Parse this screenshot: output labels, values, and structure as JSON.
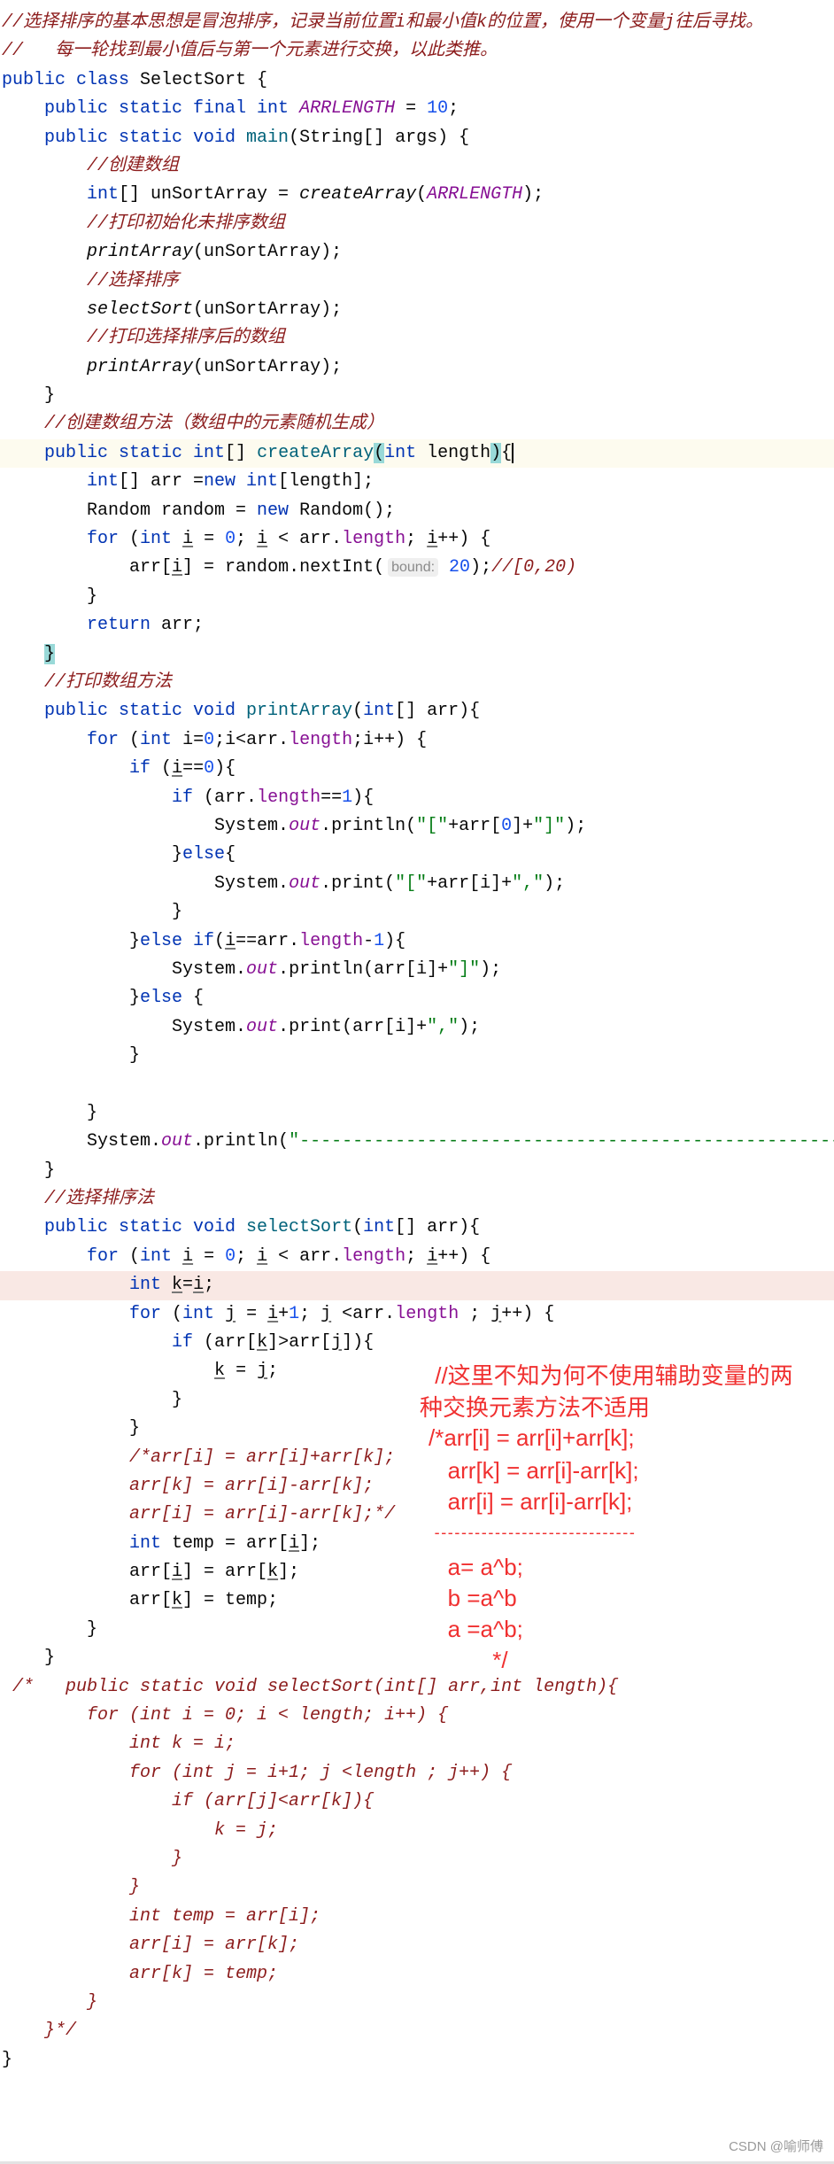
{
  "code": {
    "lines": [
      [
        [
          "//选择排序的基本思想是冒泡排序，记录当前位置i和最小值k的位置，使用一个变量j往后寻找。",
          "cm"
        ]
      ],
      [
        [
          "//   每一轮找到最小值后与第一个元素进行交换，以此类推。",
          "cm"
        ]
      ],
      [
        [
          "public class ",
          "kw"
        ],
        [
          "SelectSort {",
          ""
        ]
      ],
      [
        [
          "    public static final int ",
          "kw"
        ],
        [
          "ARRLENGTH",
          "cst"
        ],
        [
          " = ",
          ""
        ],
        [
          "10",
          "num"
        ],
        [
          ";",
          ""
        ]
      ],
      [
        [
          "    public static void ",
          "kw"
        ],
        [
          "main",
          "fn"
        ],
        [
          "(String[] args) {",
          ""
        ]
      ],
      [
        [
          "        //创建数组",
          "cm"
        ]
      ],
      [
        [
          "        int",
          "kw"
        ],
        [
          "[] unSortArray = ",
          ""
        ],
        [
          "createArray",
          "it"
        ],
        [
          "(",
          ""
        ],
        [
          "ARRLENGTH",
          "cst"
        ],
        [
          ");",
          ""
        ]
      ],
      [
        [
          "        //打印初始化未排序数组",
          "cm"
        ]
      ],
      [
        [
          "        printArray",
          "it"
        ],
        [
          "(unSortArray);",
          ""
        ]
      ],
      [
        [
          "        //选择排序",
          "cm"
        ]
      ],
      [
        [
          "        selectSort",
          "it"
        ],
        [
          "(unSortArray);",
          ""
        ]
      ],
      [
        [
          "        //打印选择排序后的数组",
          "cm"
        ]
      ],
      [
        [
          "        printArray",
          "it"
        ],
        [
          "(unSortArray);",
          ""
        ]
      ],
      [
        [
          "    }",
          ""
        ]
      ],
      [
        [
          "    //创建数组方法（数组中的元素随机生成）",
          "cm"
        ]
      ],
      [
        [
          "    public static int",
          "kw"
        ],
        [
          "[] ",
          ""
        ],
        [
          "createArray",
          "fn"
        ],
        [
          "(",
          "br"
        ],
        [
          "int",
          "kw"
        ],
        [
          " length",
          ""
        ],
        [
          ")",
          "br"
        ],
        [
          "{",
          "caret"
        ]
      ],
      [
        [
          "        int",
          "kw"
        ],
        [
          "[] arr =",
          ""
        ],
        [
          "new int",
          "kw"
        ],
        [
          "[length];",
          ""
        ]
      ],
      [
        [
          "        Random random = ",
          ""
        ],
        [
          "new",
          "kw"
        ],
        [
          " Random();",
          ""
        ]
      ],
      [
        [
          "        for ",
          "kw"
        ],
        [
          "(",
          ""
        ],
        [
          "int ",
          "kw"
        ],
        [
          "i",
          "u"
        ],
        [
          " = ",
          ""
        ],
        [
          "0",
          "num"
        ],
        [
          "; ",
          ""
        ],
        [
          "i",
          "u"
        ],
        [
          " < arr.",
          ""
        ],
        [
          "length",
          "fld"
        ],
        [
          "; ",
          ""
        ],
        [
          "i",
          "u"
        ],
        [
          "++) {",
          ""
        ]
      ],
      [
        [
          "            arr[",
          ""
        ],
        [
          "i",
          "u"
        ],
        [
          "] = random.nextInt(",
          ""
        ],
        [
          "bound:",
          "hint"
        ],
        [
          " ",
          ""
        ],
        [
          "20",
          "num"
        ],
        [
          ");",
          ""
        ],
        [
          "//[0,20)",
          "cm"
        ]
      ],
      [
        [
          "        }",
          ""
        ]
      ],
      [
        [
          "        return",
          "kw"
        ],
        [
          " arr;",
          ""
        ]
      ],
      [
        [
          "    ",
          ""
        ],
        [
          "}",
          "brc"
        ]
      ],
      [
        [
          "    //打印数组方法",
          "cm"
        ]
      ],
      [
        [
          "    public static void ",
          "kw"
        ],
        [
          "printArray",
          "fn"
        ],
        [
          "(",
          ""
        ],
        [
          "int",
          "kw"
        ],
        [
          "[] arr){",
          ""
        ]
      ],
      [
        [
          "        for ",
          "kw"
        ],
        [
          "(",
          ""
        ],
        [
          "int ",
          "kw"
        ],
        [
          "i=",
          ""
        ],
        [
          "0",
          "num"
        ],
        [
          ";i<arr.",
          ""
        ],
        [
          "length",
          "fld"
        ],
        [
          ";i++) {",
          ""
        ]
      ],
      [
        [
          "            if ",
          "kw"
        ],
        [
          "(",
          ""
        ],
        [
          "i",
          "u"
        ],
        [
          "==",
          ""
        ],
        [
          "0",
          "num"
        ],
        [
          "){",
          ""
        ]
      ],
      [
        [
          "                if ",
          "kw"
        ],
        [
          "(arr.",
          ""
        ],
        [
          "length",
          "fld"
        ],
        [
          "==",
          ""
        ],
        [
          "1",
          "num"
        ],
        [
          "){",
          ""
        ]
      ],
      [
        [
          "                    System.",
          ""
        ],
        [
          "out",
          "sfld"
        ],
        [
          ".println(",
          ""
        ],
        [
          "\"[\"",
          "str"
        ],
        [
          "+arr[",
          ""
        ],
        [
          "0",
          "num"
        ],
        [
          "]+",
          ""
        ],
        [
          "\"]\"",
          "str"
        ],
        [
          ");",
          ""
        ]
      ],
      [
        [
          "                }",
          ""
        ],
        [
          "else",
          "kw"
        ],
        [
          "{",
          ""
        ]
      ],
      [
        [
          "                    System.",
          ""
        ],
        [
          "out",
          "sfld"
        ],
        [
          ".print(",
          ""
        ],
        [
          "\"[\"",
          "str"
        ],
        [
          "+arr[i]+",
          ""
        ],
        [
          "\",\"",
          "str"
        ],
        [
          ");",
          ""
        ]
      ],
      [
        [
          "                }",
          ""
        ]
      ],
      [
        [
          "            }",
          ""
        ],
        [
          "else if",
          "kw"
        ],
        [
          "(",
          ""
        ],
        [
          "i",
          "u"
        ],
        [
          "==arr.",
          ""
        ],
        [
          "length",
          "fld"
        ],
        [
          "-",
          ""
        ],
        [
          "1",
          "num"
        ],
        [
          "){",
          ""
        ]
      ],
      [
        [
          "                System.",
          ""
        ],
        [
          "out",
          "sfld"
        ],
        [
          ".println(arr[i]+",
          ""
        ],
        [
          "\"]\"",
          "str"
        ],
        [
          ");",
          ""
        ]
      ],
      [
        [
          "            }",
          ""
        ],
        [
          "else",
          "kw"
        ],
        [
          " {",
          ""
        ]
      ],
      [
        [
          "                System.",
          ""
        ],
        [
          "out",
          "sfld"
        ],
        [
          ".print(arr[i]+",
          ""
        ],
        [
          "\",\"",
          "str"
        ],
        [
          ");",
          ""
        ]
      ],
      [
        [
          "            }",
          ""
        ]
      ],
      [
        [
          "",
          ""
        ]
      ],
      [
        [
          "        }",
          ""
        ]
      ],
      [
        [
          "        System.",
          ""
        ],
        [
          "out",
          "sfld"
        ],
        [
          ".println(",
          ""
        ],
        [
          "\"------------------------------------------------------",
          "str"
        ]
      ],
      [
        [
          "    }",
          ""
        ]
      ],
      [
        [
          "    //选择排序法",
          "cm"
        ]
      ],
      [
        [
          "    public static void ",
          "kw"
        ],
        [
          "selectSort",
          "fn"
        ],
        [
          "(",
          ""
        ],
        [
          "int",
          "kw"
        ],
        [
          "[] arr){",
          ""
        ]
      ],
      [
        [
          "        for ",
          "kw"
        ],
        [
          "(",
          ""
        ],
        [
          "int ",
          "kw"
        ],
        [
          "i",
          "u"
        ],
        [
          " = ",
          ""
        ],
        [
          "0",
          "num"
        ],
        [
          "; ",
          ""
        ],
        [
          "i",
          "u"
        ],
        [
          " < arr.",
          ""
        ],
        [
          "length",
          "fld"
        ],
        [
          "; ",
          ""
        ],
        [
          "i",
          "u"
        ],
        [
          "++) {",
          ""
        ]
      ],
      [
        [
          "            int ",
          "kw"
        ],
        [
          "k",
          "u"
        ],
        [
          "=",
          ""
        ],
        [
          "i",
          "u"
        ],
        [
          ";",
          ""
        ]
      ],
      [
        [
          "            for ",
          "kw"
        ],
        [
          "(",
          ""
        ],
        [
          "int ",
          "kw"
        ],
        [
          "j",
          "u"
        ],
        [
          " = ",
          ""
        ],
        [
          "i",
          "u"
        ],
        [
          "+",
          ""
        ],
        [
          "1",
          "num"
        ],
        [
          "; ",
          ""
        ],
        [
          "j",
          "u"
        ],
        [
          " <arr.",
          ""
        ],
        [
          "length",
          "fld"
        ],
        [
          " ; ",
          ""
        ],
        [
          "j",
          "u"
        ],
        [
          "++) {",
          ""
        ]
      ],
      [
        [
          "                if ",
          "kw"
        ],
        [
          "(arr[",
          ""
        ],
        [
          "k",
          "u"
        ],
        [
          "]>arr[",
          ""
        ],
        [
          "j",
          "u"
        ],
        [
          "]){",
          ""
        ]
      ],
      [
        [
          "                    ",
          ""
        ],
        [
          "k",
          "u"
        ],
        [
          " = ",
          ""
        ],
        [
          "j",
          "u"
        ],
        [
          ";",
          ""
        ]
      ],
      [
        [
          "                }",
          ""
        ]
      ],
      [
        [
          "            }",
          ""
        ]
      ],
      [
        [
          "            /*arr[i] = arr[i]+arr[k];",
          "cm"
        ]
      ],
      [
        [
          "            arr[k] = arr[i]-arr[k];",
          "cm"
        ]
      ],
      [
        [
          "            arr[i] = arr[i]-arr[k];*/",
          "cm"
        ]
      ],
      [
        [
          "            int",
          "kw"
        ],
        [
          " temp = arr[",
          ""
        ],
        [
          "i",
          "u"
        ],
        [
          "];",
          ""
        ]
      ],
      [
        [
          "            arr[",
          ""
        ],
        [
          "i",
          "u"
        ],
        [
          "] = arr[",
          ""
        ],
        [
          "k",
          "u"
        ],
        [
          "];",
          ""
        ]
      ],
      [
        [
          "            arr[",
          ""
        ],
        [
          "k",
          "u"
        ],
        [
          "] = temp;",
          ""
        ]
      ],
      [
        [
          "        }",
          ""
        ]
      ],
      [
        [
          "    }",
          ""
        ]
      ],
      [
        [
          " /*   public static void selectSort(int[] arr,int length){",
          "cm"
        ]
      ],
      [
        [
          "        for (int i = 0; i < length; i++) {",
          "cm"
        ]
      ],
      [
        [
          "            int k = i;",
          "cm"
        ]
      ],
      [
        [
          "            for (int j = i+1; j <length ; j++) {",
          "cm"
        ]
      ],
      [
        [
          "                if (arr[j]<arr[k]){",
          "cm"
        ]
      ],
      [
        [
          "                    k = j;",
          "cm"
        ]
      ],
      [
        [
          "                }",
          "cm"
        ]
      ],
      [
        [
          "            }",
          "cm"
        ]
      ],
      [
        [
          "            int temp = arr[i];",
          "cm"
        ]
      ],
      [
        [
          "            arr[i] = arr[k];",
          "cm"
        ]
      ],
      [
        [
          "            arr[k] = temp;",
          "cm"
        ]
      ],
      [
        [
          "        }",
          "cm"
        ]
      ],
      [
        [
          "    }*/",
          "cm"
        ]
      ],
      [
        [
          "}",
          ""
        ]
      ]
    ],
    "highlighted_lines": {
      "15": "hl-yellow",
      "44": "hl-pink"
    }
  },
  "notes": {
    "color": "#f03030",
    "lines": [
      " //这里不知为何不使用辅助变量的两",
      "种交换元素方法不适用",
      "/*arr[i] = arr[i]+arr[k];",
      "   arr[k] = arr[i]-arr[k];",
      "   arr[i] = arr[i]-arr[k];",
      " ------------------------------",
      "   a= a^b;",
      "   b =a^b",
      "   a =a^b;",
      "          */"
    ]
  },
  "watermark": "CSDN @喻师傅"
}
